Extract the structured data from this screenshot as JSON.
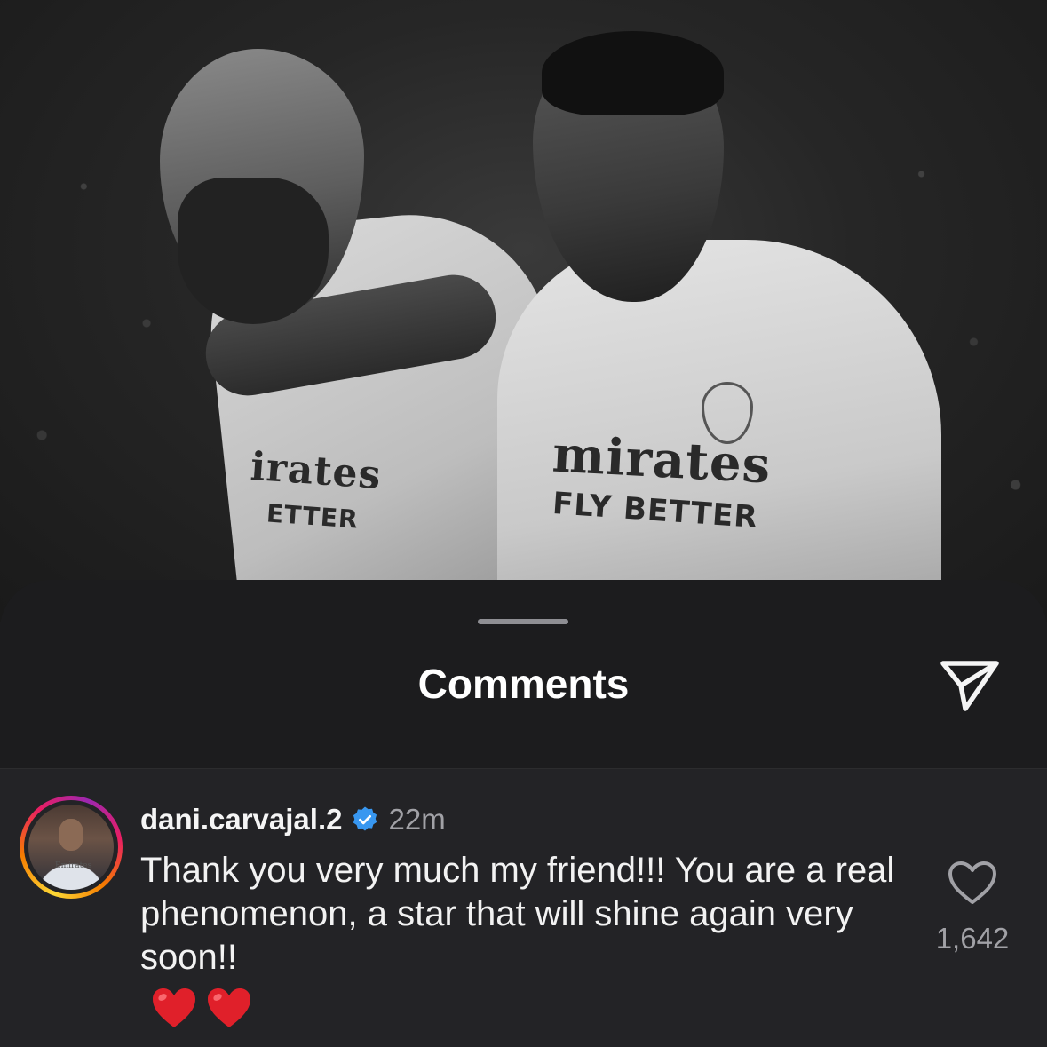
{
  "sheet": {
    "title": "Comments",
    "share_icon": "paper-plane-icon"
  },
  "comment": {
    "username": "dani.carvajal.2",
    "verified": true,
    "time": "22m",
    "text": "Thank you very much my friend!!! You are a real phenomenon, a star that will shine again very soon!!",
    "emojis": [
      "red-heart",
      "red-heart"
    ],
    "like_icon": "heart-outline-icon",
    "likes": "1,642"
  },
  "background_photo": {
    "sponsor_main": "Emirates",
    "sponsor_sub": "FLY BETTER"
  },
  "colors": {
    "sheet_bg": "#1c1c1e",
    "comment_bg": "#232326",
    "verified_blue": "#3897f0",
    "secondary_text": "#a1a1a6",
    "heart_red": "#e0202a"
  }
}
